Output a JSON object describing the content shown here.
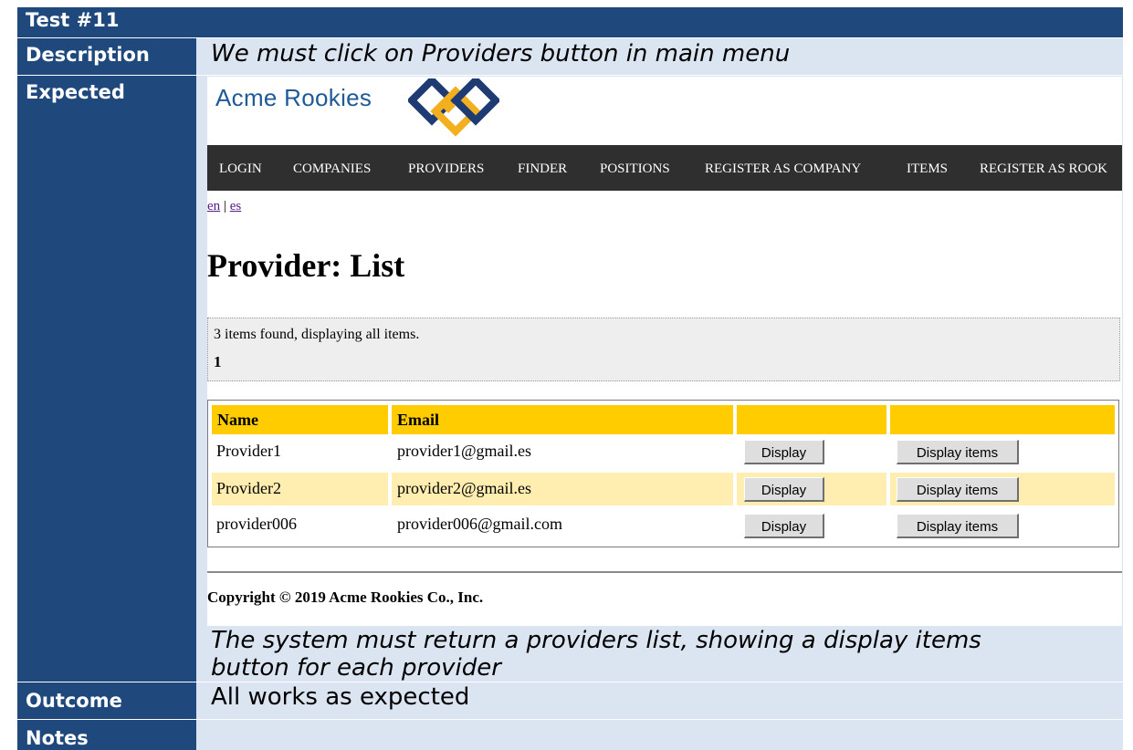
{
  "report": {
    "title": "Test #11",
    "description_label": "Description",
    "description_value": "We must click on Providers button in main menu",
    "expected_label": "Expected",
    "expected_text_line1": "The system must return a providers list, showing a display items",
    "expected_text_line2": "button for each provider",
    "outcome_label": "Outcome",
    "outcome_value": "All works as expected",
    "notes_label": "Notes"
  },
  "site": {
    "logo_text": "Acme Rookies",
    "menu": [
      "LOGIN",
      "COMPANIES",
      "PROVIDERS",
      "FINDER",
      "POSITIONS",
      "REGISTER AS COMPANY",
      "ITEMS",
      "REGISTER AS ROOK"
    ],
    "lang_en": "en",
    "lang_sep": "|",
    "lang_es": "es",
    "heading": "Provider: List",
    "pager_text": "3 items found, displaying all items.",
    "pager_page": "1",
    "table": {
      "headers": [
        "Name",
        "Email",
        "",
        ""
      ],
      "rows": [
        {
          "name": "Provider1",
          "email": "provider1@gmail.es",
          "display": "Display",
          "items": "Display items"
        },
        {
          "name": "Provider2",
          "email": "provider2@gmail.es",
          "display": "Display",
          "items": "Display items"
        },
        {
          "name": "provider006",
          "email": "provider006@gmail.com",
          "display": "Display",
          "items": "Display items"
        }
      ]
    },
    "copyright": "Copyright © 2019 Acme Rookies Co., Inc."
  },
  "colors": {
    "label_bg": "#1f497d",
    "value_bg": "#dbe5f1",
    "menu_bg": "#2f2f2f",
    "table_header": "#ffcc00",
    "row_alt": "#ffeeb0"
  }
}
